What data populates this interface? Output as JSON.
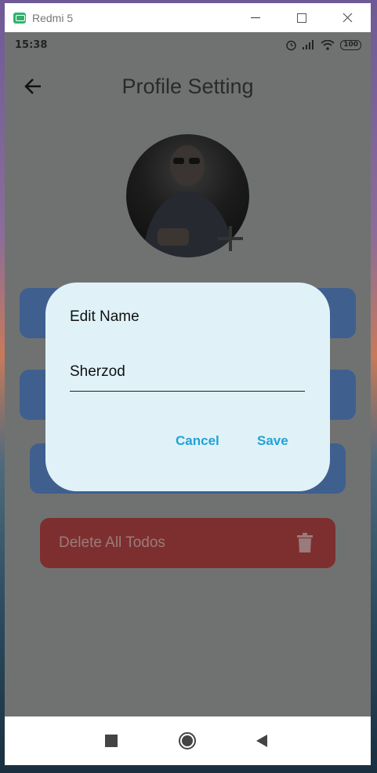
{
  "window": {
    "title": "Redmi 5",
    "minimize": "—",
    "maximize": "☐",
    "close": "✕"
  },
  "status_bar": {
    "time": "15:38",
    "battery": "100"
  },
  "appbar": {
    "title": "Profile Setting"
  },
  "delete_button": {
    "label": "Delete All Todos"
  },
  "dialog": {
    "title": "Edit Name",
    "name_value": "Sherzod",
    "cancel_label": "Cancel",
    "save_label": "Save"
  },
  "colors": {
    "accent": "#1fa3d6",
    "dialog_bg": "#e0f2f8",
    "delete_red": "#7d2f2f",
    "card_blue": "#3f5f8f"
  },
  "icons": [
    "back-arrow-icon",
    "plus-icon",
    "trash-icon",
    "alarm-icon",
    "signal-icon",
    "wifi-icon",
    "battery-icon",
    "square-icon",
    "circle-icon",
    "triangle-icon"
  ]
}
